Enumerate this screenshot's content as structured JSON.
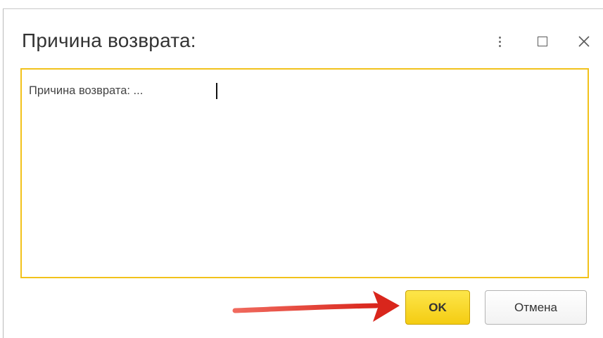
{
  "dialog": {
    "title": "Причина возврата:",
    "more_icon": "more-vertical-icon",
    "maximize_icon": "maximize-icon",
    "close_icon": "close-icon",
    "close_glyph": "✕"
  },
  "reason_field": {
    "value": "Причина возврата: ..."
  },
  "buttons": {
    "ok_label": "OK",
    "cancel_label": "Отмена"
  },
  "annotation": {
    "arrow": "red-arrow-pointing-at-ok-button",
    "color": "#e03127"
  },
  "colors": {
    "focus_border": "#f2c21b",
    "ok_button": "#f7d320"
  }
}
